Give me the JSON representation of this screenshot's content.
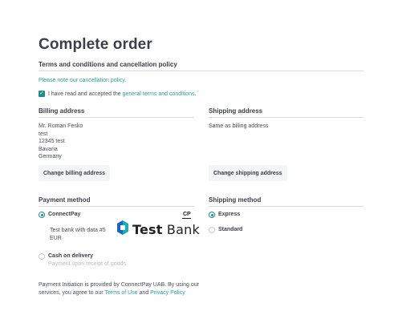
{
  "page": {
    "title": "Complete order"
  },
  "terms": {
    "heading": "Terms and conditions and cancellation policy",
    "note_link": "Please note our cancellation policy.",
    "accept_prefix": "I have read and accepted the ",
    "accept_link": "general terms and conditions.",
    "accept_checked": true
  },
  "billing": {
    "heading": "Billing address",
    "lines": [
      "Mr. Roman Fesko",
      "test",
      "12345 test",
      "Bavaria",
      "Germany"
    ],
    "change_button": "Change billing address"
  },
  "shipping_address": {
    "heading": "Shipping address",
    "text": "Same as billing address",
    "change_button": "Change shipping address"
  },
  "payment": {
    "heading": "Payment method",
    "options": [
      {
        "label": "ConnectPay",
        "selected": true,
        "detail_line1": "Test bank with data #5",
        "detail_line2": "EUR",
        "bank_logo": {
          "word_bold": "Test",
          "word_light": "Bank",
          "badge": "CP",
          "icon": "connectpay-bank-icon"
        }
      },
      {
        "label": "Cash on delivery",
        "selected": false,
        "detail_line1": "Payment upon receipt of goods."
      }
    ],
    "footer_prefix": "Payment Initiation is provided by ConnectPay UAB. By using our",
    "footer_line2_prefix": "services, you agree to our ",
    "terms_link": "Terms of Use",
    "and_text": " and ",
    "privacy_link": "Privacy Policy"
  },
  "shipping_method": {
    "heading": "Shipping method",
    "options": [
      {
        "label": "Express",
        "selected": true
      },
      {
        "label": "Standard",
        "selected": false
      }
    ]
  },
  "colors": {
    "accent": "#1f8f8b",
    "link": "#2a9d99",
    "text": "#3b3f47"
  }
}
